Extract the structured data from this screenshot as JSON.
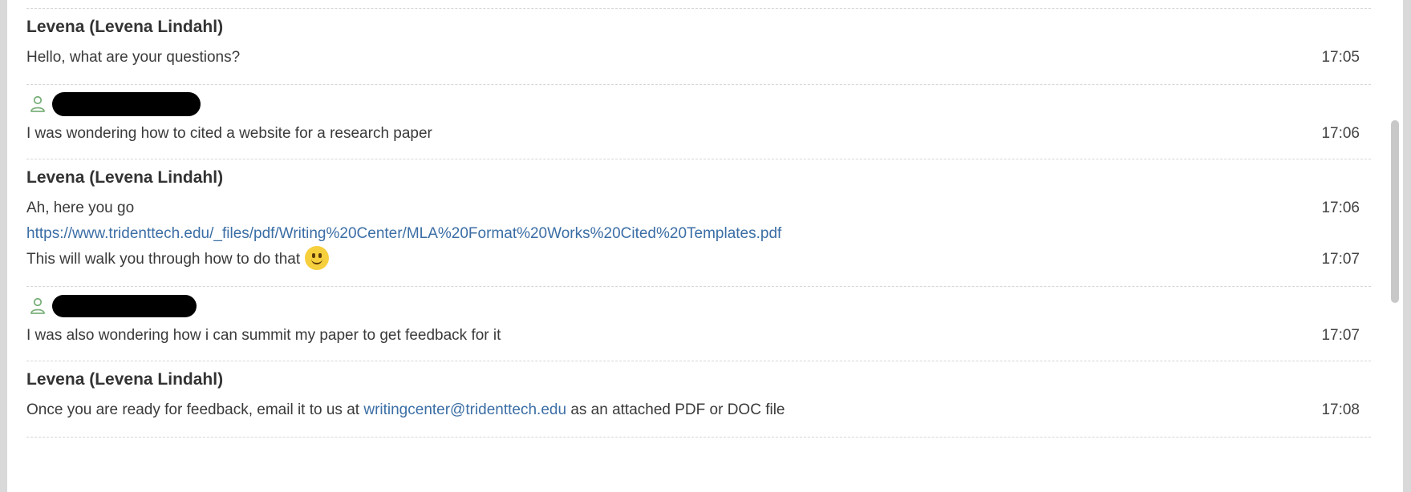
{
  "messages": [
    {
      "type": "agent",
      "sender": "Levena (Levena Lindahl)",
      "lines": [
        {
          "text": "Hello, what are your questions?",
          "time": "17:05"
        }
      ]
    },
    {
      "type": "user",
      "lines": [
        {
          "text": "I was wondering how to cited a website for a research paper",
          "time": "17:06"
        }
      ]
    },
    {
      "type": "agent",
      "sender": "Levena (Levena Lindahl)",
      "lines": [
        {
          "text": "Ah, here you go",
          "time": "17:06"
        },
        {
          "link": "https://www.tridenttech.edu/_files/pdf/Writing%20Center/MLA%20Format%20Works%20Cited%20Templates.pdf"
        },
        {
          "text": "This will walk you through how to do that",
          "time": "17:07",
          "emoji": "smiley-emoji"
        }
      ]
    },
    {
      "type": "user",
      "lines": [
        {
          "text": "I was also wondering how i can summit my paper to get feedback for it",
          "time": "17:07"
        }
      ]
    },
    {
      "type": "agent",
      "sender": "Levena (Levena Lindahl)",
      "lines": [
        {
          "text_before": "Once you are ready for feedback, email it to us at ",
          "email": "writingcenter@tridenttech.edu",
          "text_after": " as an attached PDF or DOC file",
          "time": "17:08"
        }
      ]
    }
  ],
  "colors": {
    "link": "#3b6ea5",
    "user_icon": "#7bb07b",
    "emoji": "#f6cf3d",
    "redaction": "#000000"
  },
  "icons": {
    "user": "person-outline-icon"
  }
}
